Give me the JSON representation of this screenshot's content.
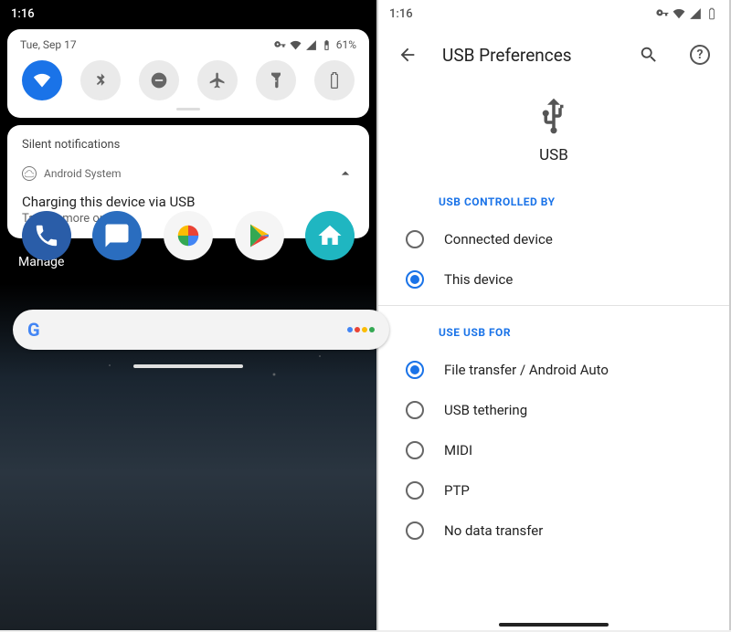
{
  "left": {
    "status_time": "1:16",
    "qs_date": "Tue, Sep 17",
    "battery_pct": "61%",
    "quick_settings": {
      "tiles": [
        {
          "name": "wifi-icon",
          "active": true
        },
        {
          "name": "bluetooth-icon",
          "active": false
        },
        {
          "name": "dnd-icon",
          "active": false
        },
        {
          "name": "airplane-icon",
          "active": false
        },
        {
          "name": "flashlight-icon",
          "active": false
        },
        {
          "name": "battery-saver-icon",
          "active": false
        }
      ]
    },
    "notifications": {
      "section_title": "Silent notifications",
      "app_name": "Android System",
      "title": "Charging this device via USB",
      "subtitle": "Tap for more options."
    },
    "manage_label": "Manage",
    "dock": [
      "phone-icon",
      "messages-icon",
      "photos-icon",
      "play-store-icon",
      "launcher-icon"
    ]
  },
  "right": {
    "status_time": "1:16",
    "page_title": "USB Preferences",
    "hero_label": "USB",
    "section1": {
      "header": "USB CONTROLLED BY",
      "options": [
        {
          "label": "Connected device",
          "checked": false
        },
        {
          "label": "This device",
          "checked": true
        }
      ]
    },
    "section2": {
      "header": "USE USB FOR",
      "options": [
        {
          "label": "File transfer / Android Auto",
          "checked": true
        },
        {
          "label": "USB tethering",
          "checked": false
        },
        {
          "label": "MIDI",
          "checked": false
        },
        {
          "label": "PTP",
          "checked": false
        },
        {
          "label": "No data transfer",
          "checked": false
        }
      ]
    }
  }
}
